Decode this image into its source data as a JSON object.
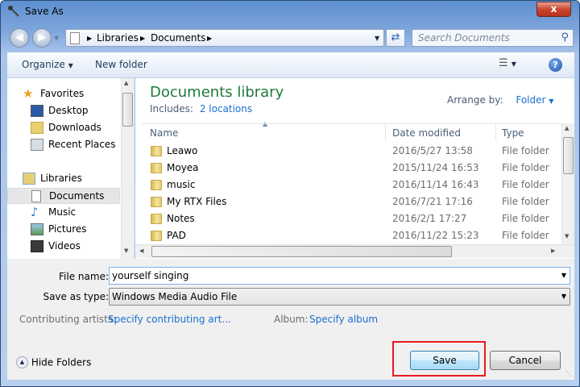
{
  "window": {
    "title": "Save As",
    "close_label": "x"
  },
  "address": {
    "segments": [
      "Libraries",
      "Documents"
    ]
  },
  "search": {
    "placeholder": "Search Documents"
  },
  "toolbar": {
    "organize": "Organize",
    "new_folder": "New folder"
  },
  "nav": {
    "favorites": "Favorites",
    "favorites_items": [
      "Desktop",
      "Downloads",
      "Recent Places"
    ],
    "libraries": "Libraries",
    "libraries_items": [
      "Documents",
      "Music",
      "Pictures",
      "Videos"
    ],
    "selected": "Documents"
  },
  "library": {
    "title": "Documents library",
    "includes_label": "Includes:",
    "includes_link": "2 locations",
    "arrange_label": "Arrange by:",
    "arrange_value": "Folder"
  },
  "columns": [
    "Name",
    "Date modified",
    "Type"
  ],
  "files": [
    {
      "name": "Leawo",
      "date": "2016/5/27 13:58",
      "type": "File folder"
    },
    {
      "name": "Moyea",
      "date": "2015/11/24 16:53",
      "type": "File folder"
    },
    {
      "name": "music",
      "date": "2016/11/14 16:43",
      "type": "File folder"
    },
    {
      "name": "My RTX Files",
      "date": "2016/7/21 17:16",
      "type": "File folder"
    },
    {
      "name": "Notes",
      "date": "2016/2/1 17:27",
      "type": "File folder"
    },
    {
      "name": "PAD",
      "date": "2016/11/22 15:23",
      "type": "File folder"
    }
  ],
  "form": {
    "file_name_label": "File name:",
    "file_name_value": "yourself singing",
    "save_type_label": "Save as type:",
    "save_type_value": "Windows Media Audio File",
    "artists_label": "Contributing artists:",
    "artists_link": "Specify contributing art...",
    "album_label": "Album:",
    "album_link": "Specify album"
  },
  "footer": {
    "hide_folders": "Hide Folders",
    "save": "Save",
    "cancel": "Cancel"
  },
  "colors": {
    "highlight": "#e8191d",
    "link": "#1a6fcf",
    "library_title": "#1e7a3a"
  }
}
